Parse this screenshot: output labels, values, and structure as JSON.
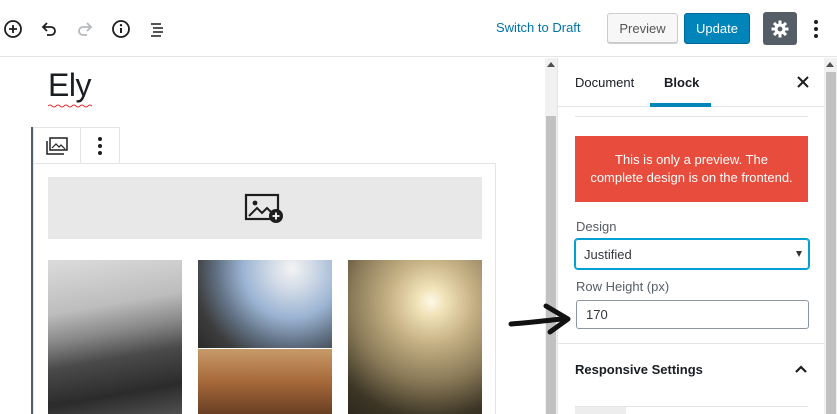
{
  "toolbar": {
    "switch_to_draft": "Switch to Draft",
    "preview": "Preview",
    "update": "Update",
    "icons": [
      "add-block-icon",
      "undo-icon",
      "redo-icon",
      "info-icon",
      "outline-icon",
      "gear-icon",
      "more-options-icon"
    ]
  },
  "editor": {
    "title": "Ely",
    "block_toolbar": [
      "gallery-icon",
      "more-vertical-icon"
    ],
    "add_image_icon": "image-add-icon"
  },
  "sidebar": {
    "tabs": {
      "document": "Document",
      "block": "Block"
    },
    "active_tab": "Block",
    "notice": "This is only a preview. The complete design is on the frontend.",
    "notice_color": "#e74c3c",
    "design_label": "Design",
    "design_value": "Justified",
    "row_height_label": "Row Height (px)",
    "row_height_value": "170",
    "responsive_title": "Responsive Settings"
  },
  "colors": {
    "accent": "#0085ba",
    "link": "#0073aa",
    "settings_bg": "#555d66"
  }
}
